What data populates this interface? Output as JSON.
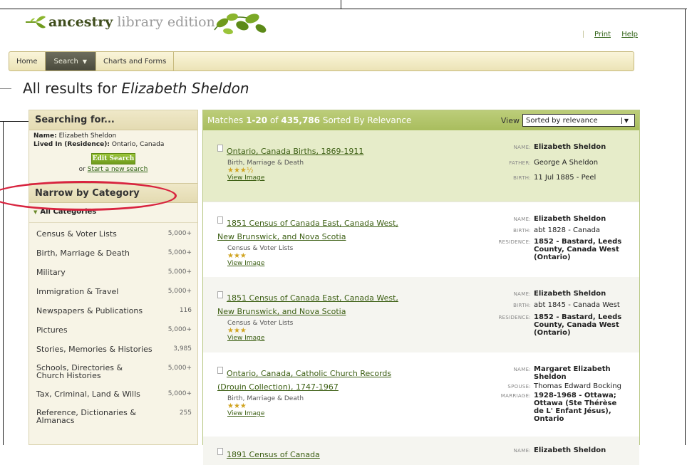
{
  "header": {
    "brand_primary": "ancestry",
    "brand_secondary": "library edition",
    "links": [
      "Print",
      "Help"
    ]
  },
  "nav": {
    "items": [
      {
        "label": "Home"
      },
      {
        "label": "Search",
        "active": true
      },
      {
        "label": "Charts and Forms"
      }
    ]
  },
  "page": {
    "title_prefix": "All results for",
    "title_query": "Elizabeth Sheldon"
  },
  "sidebar": {
    "searching_title": "Searching for...",
    "name_label": "Name:",
    "name_value": "Elizabeth Sheldon",
    "lived_label": "Lived In (Residence):",
    "lived_value": "Ontario, Canada",
    "edit_button": "Edit Search",
    "or_text": "or",
    "new_search_link": "Start a new search",
    "narrow_title": "Narrow by Category",
    "all_categories": "All Categories",
    "categories": [
      {
        "label": "Census & Voter Lists",
        "count": "5,000+"
      },
      {
        "label": "Birth, Marriage & Death",
        "count": "5,000+"
      },
      {
        "label": "Military",
        "count": "5,000+"
      },
      {
        "label": "Immigration & Travel",
        "count": "5,000+"
      },
      {
        "label": "Newspapers & Publications",
        "count": "116"
      },
      {
        "label": "Pictures",
        "count": "5,000+"
      },
      {
        "label": "Stories, Memories & Histories",
        "count": "3,985"
      },
      {
        "label": "Schools, Directories & Church Histories",
        "count": "5,000+"
      },
      {
        "label": "Tax, Criminal, Land & Wills",
        "count": "5,000+"
      },
      {
        "label": "Reference, Dictionaries & Almanacs",
        "count": "255"
      }
    ]
  },
  "results": {
    "header_prefix": "Matches",
    "header_range": "1-20",
    "header_of": "of",
    "header_total": "435,786",
    "header_suffix": "Sorted By Relevance",
    "view_label": "View",
    "view_selected": "Sorted by relevance",
    "items": [
      {
        "title": "Ontario, Canada Births, 1869-1911",
        "category": "Birth, Marriage & Death",
        "stars": "★★★½",
        "view_image": "View Image",
        "fields": [
          {
            "label": "NAME:",
            "value": "Elizabeth Sheldon",
            "bold": true
          },
          {
            "label": "FATHER:",
            "value": "George A Sheldon"
          },
          {
            "label": "BIRTH:",
            "value": "11 Jul 1885 - Peel"
          }
        ]
      },
      {
        "title": "1851 Census of Canada East, Canada West, New Brunswick, and Nova Scotia",
        "category": "Census & Voter Lists",
        "stars": "★★★",
        "view_image": "View Image",
        "fields": [
          {
            "label": "NAME:",
            "value": "Elizabeth Sheldon",
            "bold": true
          },
          {
            "label": "BIRTH:",
            "value": "abt 1828 - Canada"
          },
          {
            "label": "RESIDENCE:",
            "value": "1852 - Bastard, Leeds County, Canada West (Ontario)"
          }
        ]
      },
      {
        "title": "1851 Census of Canada East, Canada West, New Brunswick, and Nova Scotia",
        "category": "Census & Voter Lists",
        "stars": "★★★",
        "view_image": "View Image",
        "fields": [
          {
            "label": "NAME:",
            "value": "Elizabeth Sheldon",
            "bold": true
          },
          {
            "label": "BIRTH:",
            "value": "abt 1845 - Canada West"
          },
          {
            "label": "RESIDENCE:",
            "value": "1852 - Bastard, Leeds County, Canada West (Ontario)"
          }
        ]
      },
      {
        "title": "Ontario, Canada, Catholic Church Records (Drouin Collection), 1747-1967",
        "category": "Birth, Marriage & Death",
        "stars": "★★★",
        "view_image": "View Image",
        "fields": [
          {
            "label": "NAME:",
            "value": "Margaret Elizabeth Sheldon",
            "bold": true
          },
          {
            "label": "SPOUSE:",
            "value": "Thomas Edward Bocking"
          },
          {
            "label": "MARRIAGE:",
            "value": "1928-1968 - Ottawa; Ottawa (Ste Thérèse de L' Enfant Jésus), Ontario"
          }
        ]
      },
      {
        "title": "1891 Census of Canada",
        "category": "",
        "stars": "",
        "view_image": "",
        "fields": [
          {
            "label": "NAME:",
            "value": "Elizabeth Sheldon",
            "bold": true
          }
        ]
      }
    ]
  },
  "colors": {
    "brand_green": "#3f4d1c",
    "link_green": "#3b5e12",
    "highlight_circle": "#d8243f",
    "results_header": "#a9bd5e"
  }
}
